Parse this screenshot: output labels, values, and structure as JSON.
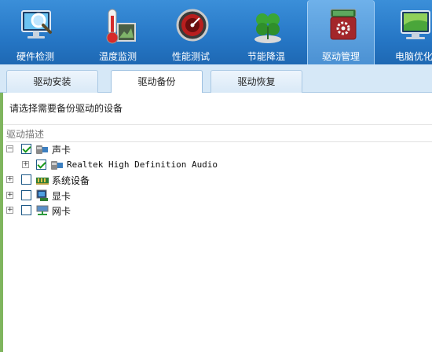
{
  "toolbar": {
    "items": [
      {
        "label": "硬件检测",
        "icon": "monitor-magnifier-icon"
      },
      {
        "label": "温度监测",
        "icon": "thermometer-icon"
      },
      {
        "label": "性能测试",
        "icon": "speedometer-icon"
      },
      {
        "label": "节能降温",
        "icon": "clover-icon"
      },
      {
        "label": "驱动管理",
        "icon": "driver-box-icon",
        "active": true
      },
      {
        "label": "电脑优化",
        "icon": "monitor-optimize-icon"
      }
    ]
  },
  "tabs": [
    {
      "label": "驱动安装"
    },
    {
      "label": "驱动备份",
      "active": true
    },
    {
      "label": "驱动恢复"
    }
  ],
  "prompt": "请选择需要备份驱动的设备",
  "column_header": "驱动描述",
  "tree": [
    {
      "label": "声卡",
      "expander": "−",
      "checked": true,
      "icon": "sound-card-icon"
    },
    {
      "label": "Realtek High Definition Audio",
      "expander": "+",
      "checked": true,
      "icon": "sound-card-icon"
    },
    {
      "label": "系统设备",
      "expander": "+",
      "checked": false,
      "icon": "system-device-icon"
    },
    {
      "label": "显卡",
      "expander": "+",
      "checked": false,
      "icon": "display-adapter-icon"
    },
    {
      "label": "网卡",
      "expander": "+",
      "checked": false,
      "icon": "network-adapter-icon"
    }
  ],
  "colors": {
    "toolbar_blue": "#2677c6",
    "tab_bar": "#d6e8f7",
    "check_green": "#1a9a1a"
  }
}
